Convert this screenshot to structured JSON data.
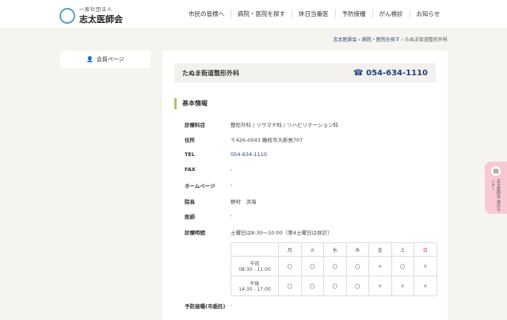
{
  "header": {
    "logo_sub": "一般社団法人",
    "logo_main": "志太医師会",
    "nav": [
      "市民の皆様へ",
      "病院・医院を探す",
      "休日当番医",
      "予防接種",
      "がん検診",
      "お知らせ"
    ]
  },
  "breadcrumb": [
    "志太医師会",
    "病院・医院を探す",
    "たぬま街道整形外科"
  ],
  "sidebar": {
    "member_label": "会員ページ"
  },
  "clinic": {
    "name": "たぬま街道整形外科",
    "phone": "054-634-1110"
  },
  "section_title": "基本情報",
  "rows": [
    {
      "k": "診療科目",
      "v": "整形外科 / リウマチ科 / リハビリテーション科"
    },
    {
      "k": "住所",
      "v": "〒426-0043 藤枝市大新島707"
    },
    {
      "k": "TEL",
      "v": "054-634-1110"
    },
    {
      "k": "FAX",
      "v": "-"
    },
    {
      "k": "ホームページ",
      "v": "-"
    },
    {
      "k": "院長",
      "v": "野村　洪海"
    },
    {
      "k": "医師",
      "v": "-"
    },
    {
      "k": "診療時間",
      "v": "土曜日は8:30～10:00（第4土曜日は休診）"
    }
  ],
  "schedule": {
    "days": [
      "月",
      "火",
      "水",
      "木",
      "金",
      "土",
      "日"
    ],
    "rows": [
      {
        "label1": "午前",
        "label2": "08:30 - 11:00",
        "marks": [
          "〇",
          "〇",
          "〇",
          "〇",
          "×",
          "〇",
          "×"
        ]
      },
      {
        "label1": "午後",
        "label2": "14:30 - 17:00",
        "marks": [
          "〇",
          "〇",
          "〇",
          "〇",
          "×",
          "×",
          "×"
        ]
      }
    ]
  },
  "vaccine_row": {
    "k": "予防接種(市委託)",
    "v": "-"
  },
  "float_tab": {
    "label": "志太医師会 検診センター"
  }
}
